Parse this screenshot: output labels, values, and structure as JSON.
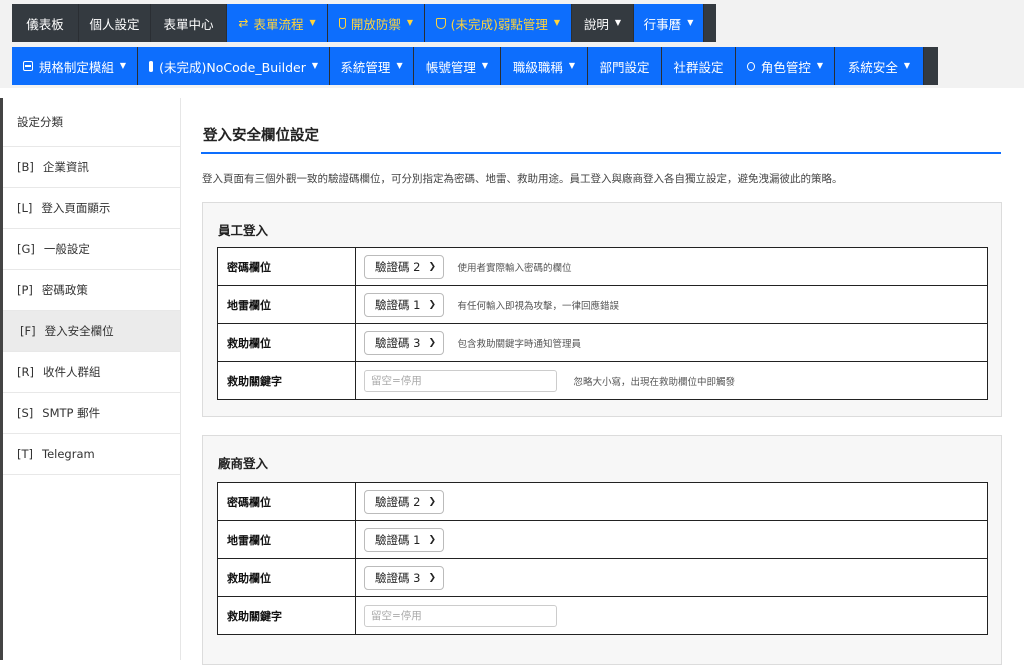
{
  "nav": {
    "row1": [
      {
        "label": "儀表板",
        "style": "dark"
      },
      {
        "label": "個人設定",
        "style": "dark"
      },
      {
        "label": "表單中心",
        "style": "dark"
      },
      {
        "label": "表單流程",
        "style": "blue",
        "icon": "swap-icon",
        "dropdown": true,
        "text_color": "#ffd43b"
      },
      {
        "label": "開放防禦",
        "style": "blue",
        "icon": "shield-icon",
        "dropdown": true,
        "text_color": "#ffd43b"
      },
      {
        "label": "(未完成)弱點管理",
        "style": "blue",
        "icon": "shield-check-icon",
        "dropdown": true,
        "text_color": "#ffd43b"
      },
      {
        "label": "說明",
        "style": "dark",
        "dropdown": true
      },
      {
        "label": "行事曆",
        "style": "blue",
        "dropdown": true
      }
    ],
    "row2": [
      {
        "label": "規格制定模組",
        "style": "blue",
        "icon": "document-icon",
        "dropdown": true
      },
      {
        "label": "(未完成)NoCode_Builder",
        "style": "blue",
        "icon": "database-icon",
        "dropdown": true
      },
      {
        "label": "系統管理",
        "style": "blue",
        "dropdown": true
      },
      {
        "label": "帳號管理",
        "style": "blue",
        "dropdown": true
      },
      {
        "label": "職級職稱",
        "style": "blue",
        "dropdown": true
      },
      {
        "label": "部門設定",
        "style": "blue"
      },
      {
        "label": "社群設定",
        "style": "blue"
      },
      {
        "label": "角色管控",
        "style": "blue",
        "icon": "person-icon",
        "dropdown": true
      },
      {
        "label": "系統安全",
        "style": "blue",
        "dropdown": true
      }
    ]
  },
  "sidebar": {
    "heading": "設定分類",
    "items": [
      {
        "code": "[B]",
        "label": "企業資訊"
      },
      {
        "code": "[L]",
        "label": "登入頁面顯示"
      },
      {
        "code": "[G]",
        "label": "一般設定"
      },
      {
        "code": "[P]",
        "label": "密碼政策"
      },
      {
        "code": "[F]",
        "label": "登入安全欄位",
        "active": true
      },
      {
        "code": "[R]",
        "label": "收件人群組"
      },
      {
        "code": "[S]",
        "label": "SMTP 郵件"
      },
      {
        "code": "[T]",
        "label": "Telegram"
      }
    ]
  },
  "main": {
    "title": "登入安全欄位設定",
    "description": "登入頁面有三個外觀一致的驗證碼欄位，可分別指定為密碼、地雷、救助用途。員工登入與廠商登入各自獨立設定，避免洩漏彼此的策略。",
    "employee": {
      "title": "員工登入",
      "rows": [
        {
          "label": "密碼欄位",
          "value": "驗證碼 2",
          "hint": "使用者實際輸入密碼的欄位"
        },
        {
          "label": "地雷欄位",
          "value": "驗證碼 1",
          "hint": "有任何輸入即視為攻擊，一律回應錯誤"
        },
        {
          "label": "救助欄位",
          "value": "驗證碼 3",
          "hint": "包含救助關鍵字時通知管理員"
        }
      ],
      "keyword": {
        "label": "救助關鍵字",
        "placeholder": "留空=停用",
        "hint": "忽略大小寫，出現在救助欄位中即觸發"
      }
    },
    "vendor": {
      "title": "廠商登入",
      "rows": [
        {
          "label": "密碼欄位",
          "value": "驗證碼 2"
        },
        {
          "label": "地雷欄位",
          "value": "驗證碼 1"
        },
        {
          "label": "救助欄位",
          "value": "驗證碼 3"
        }
      ],
      "keyword": {
        "label": "救助關鍵字",
        "placeholder": "留空=停用"
      }
    }
  },
  "colors": {
    "accent": "#0d6efd",
    "nav_dark": "#343a40",
    "nav_highlight_text": "#ffd43b"
  }
}
